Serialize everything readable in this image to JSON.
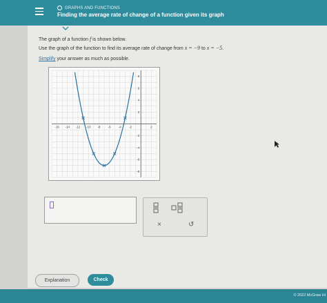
{
  "header": {
    "menu_icon": "hamburger-icon",
    "topic": "GRAPHS AND FUNCTIONS",
    "title": "Finding the average rate of change of a function given its graph",
    "collapse_icon": "chevron-down-icon"
  },
  "question": {
    "line1_pre": "The graph of a function ",
    "line1_f": "f",
    "line1_post": " is shown below.",
    "line2_pre": "Use the graph of the function to find its average rate of change from ",
    "line2_x1": "x = −9",
    "line2_mid": " to ",
    "line2_x2": "x = −5",
    "line2_post": ".",
    "simplify_link": "Simplify",
    "simplify_rest": " your answer as much as possible."
  },
  "chart_data": {
    "type": "line",
    "x_ticks": [
      "-16",
      "-14",
      "-12",
      "-10",
      "-8",
      "-6",
      "-4",
      "-2",
      "2"
    ],
    "y_ticks": [
      "8",
      "6",
      "4",
      "2",
      "-2",
      "-4",
      "-6",
      "-8"
    ],
    "xlim": [
      -17,
      3
    ],
    "ylim": [
      -9,
      9
    ],
    "grid": true,
    "curve": {
      "type": "parabola",
      "vertex": [
        -7,
        -7
      ],
      "a": 0.5
    },
    "points": [
      {
        "x": -11,
        "y": 1
      },
      {
        "x": -9,
        "y": -5
      },
      {
        "x": -7,
        "y": -7
      },
      {
        "x": -5,
        "y": -5
      },
      {
        "x": -3,
        "y": 1
      }
    ]
  },
  "answer": {
    "value": ""
  },
  "toolbar": {
    "fraction_icon": "fraction-icon",
    "mixed_number_icon": "mixed-number-icon",
    "clear_label": "×",
    "undo_label": "↺"
  },
  "buttons": {
    "explanation": "Explanation",
    "check": "Check"
  },
  "footer": {
    "copyright": "© 2022 McGraw Hi"
  },
  "colors": {
    "teal": "#2f8c9c",
    "curve": "#2a6f9c"
  }
}
